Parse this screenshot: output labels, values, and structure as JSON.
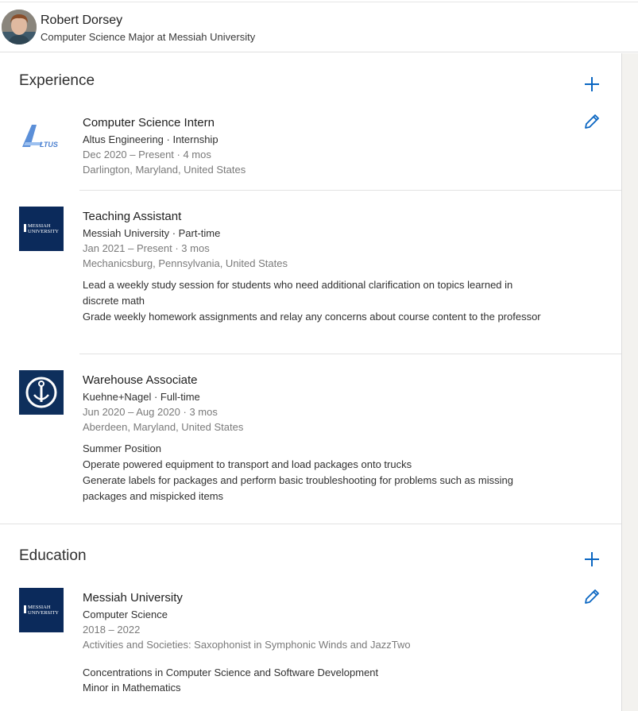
{
  "profile": {
    "name": "Robert Dorsey",
    "headline": "Computer Science Major at Messiah University"
  },
  "experience": {
    "title": "Experience",
    "items": [
      {
        "title": "Computer Science Intern",
        "company_line": "Altus Engineering · Internship",
        "dates": "Dec 2020 – Present · 4 mos",
        "location": "Darlington, Maryland, United States",
        "logo_text": "LTUS"
      },
      {
        "title": "Teaching Assistant",
        "company_line": "Messiah University · Part-time",
        "dates": "Jan 2021 – Present · 3 mos",
        "location": "Mechanicsburg, Pennsylvania, United States",
        "logo_text_1": "MESSIAH",
        "logo_text_2": "UNIVERSITY",
        "description": [
          "Lead a weekly study session for students who need additional clarification on topics learned in discrete math",
          "Grade weekly homework assignments and relay any concerns about course content to the professor"
        ]
      },
      {
        "title": "Warehouse Associate",
        "company_line": "Kuehne+Nagel · Full-time",
        "dates": "Jun 2020 – Aug 2020 · 3 mos",
        "location": "Aberdeen, Maryland, United States",
        "description": [
          "Summer Position",
          "Operate powered equipment to transport and load packages onto trucks",
          "Generate labels for packages and perform basic troubleshooting for problems such as missing packages and mispicked items"
        ]
      }
    ]
  },
  "education": {
    "title": "Education",
    "items": [
      {
        "school": "Messiah University",
        "field": "Computer Science",
        "dates": "2018 – 2022",
        "activities": "Activities and Societies: Saxophonist in Symphonic Winds and JazzTwo",
        "logo_text_1": "MESSIAH",
        "logo_text_2": "UNIVERSITY",
        "description": [
          "Concentrations in Computer Science and Software Development",
          "Minor in Mathematics"
        ]
      }
    ]
  },
  "colors": {
    "accent": "#0a66c2",
    "navy": "#0b2a5b",
    "rail": "#f3f2ef"
  }
}
